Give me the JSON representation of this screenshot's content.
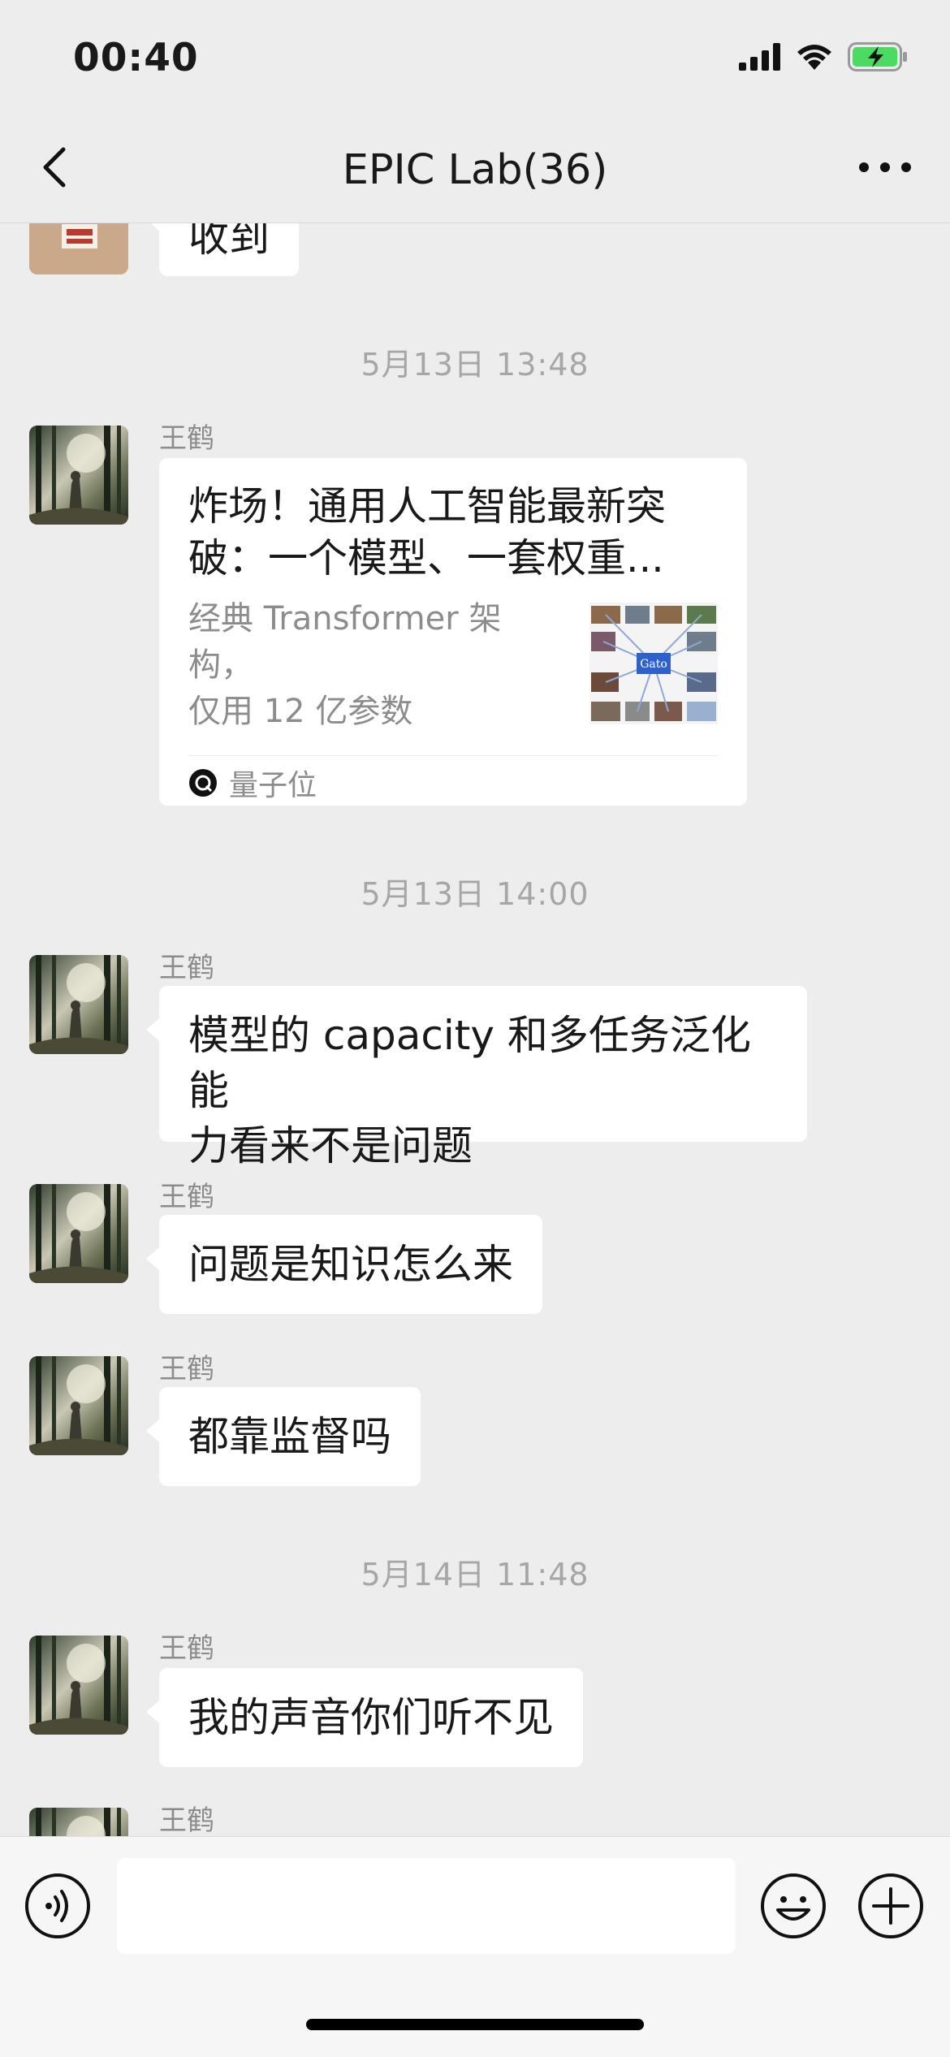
{
  "status_bar": {
    "time": "00:40"
  },
  "nav": {
    "title": "EPIC Lab(36)"
  },
  "messages": {
    "partial_top": {
      "text": "收到"
    },
    "ts1": "5月13日 13:48",
    "link_card": {
      "sender": "王鹤",
      "title_line1": "炸场！通用人工智能最新突",
      "title_line2": "破：一个模型、一套权重...",
      "desc_line1": "经典 Transformer 架构，",
      "desc_line2": "仅用 12 亿参数",
      "thumb_label": "Gato",
      "source": "量子位"
    },
    "ts2": "5月13日 14:00",
    "m1": {
      "sender": "王鹤",
      "line1": "模型的 capacity 和多任务泛化能",
      "line2": "力看来不是问题"
    },
    "m2": {
      "sender": "王鹤",
      "text": "问题是知识怎么来"
    },
    "m3": {
      "sender": "王鹤",
      "text": "都靠监督吗"
    },
    "ts3": "5月14日 11:48",
    "m4": {
      "sender": "王鹤",
      "text": "我的声音你们听不见"
    },
    "m5": {
      "sender": "王鹤"
    }
  },
  "input": {
    "placeholder": ""
  }
}
